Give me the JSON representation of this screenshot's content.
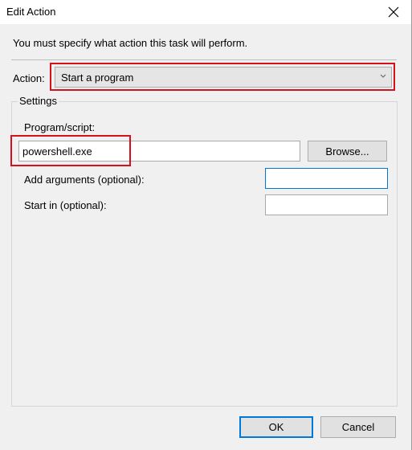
{
  "window": {
    "title": "Edit Action",
    "close_icon": "close-icon"
  },
  "instruction": "You must specify what action this task will perform.",
  "action": {
    "label": "Action:",
    "selected": "Start a program"
  },
  "settings": {
    "group_label": "Settings",
    "program_label": "Program/script:",
    "program_value": "powershell.exe",
    "browse_label": "Browse...",
    "arguments_label": "Add arguments (optional):",
    "arguments_value": "",
    "start_in_label": "Start in (optional):",
    "start_in_value": ""
  },
  "footer": {
    "ok_label": "OK",
    "cancel_label": "Cancel"
  },
  "colors": {
    "highlight": "#d4111c",
    "accent": "#0078d7",
    "dialog_bg": "#f0f0f0"
  }
}
